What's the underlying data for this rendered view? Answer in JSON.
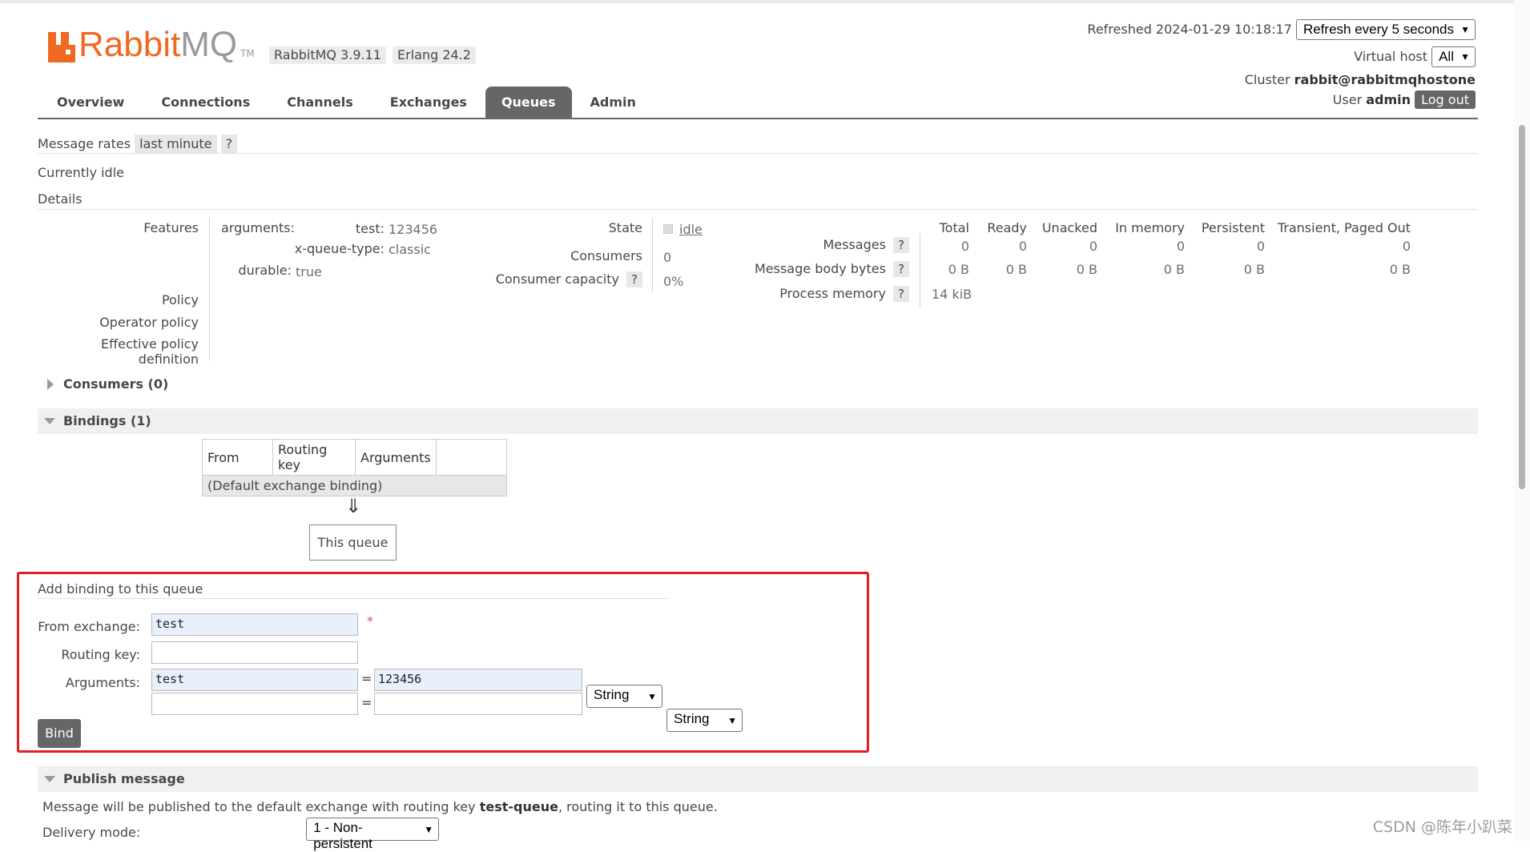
{
  "header": {
    "logo_brand": "Rabbit",
    "logo_brand_suffix": "MQ",
    "logo_tm": "TM",
    "version": "RabbitMQ 3.9.11",
    "erlang": "Erlang 24.2",
    "refreshed_label": "Refreshed 2024-01-29 10:18:17",
    "refresh_select": "Refresh every 5 seconds",
    "vhost_label": "Virtual host",
    "vhost_select": "All",
    "cluster_label": "Cluster",
    "cluster_value": "rabbit@rabbitmqhostone",
    "user_label": "User",
    "user_value": "admin",
    "logout_label": "Log out"
  },
  "tabs": [
    {
      "label": "Overview"
    },
    {
      "label": "Connections"
    },
    {
      "label": "Channels"
    },
    {
      "label": "Exchanges"
    },
    {
      "label": "Queues",
      "active": true
    },
    {
      "label": "Admin"
    }
  ],
  "rates": {
    "label": "Message rates",
    "period": "last minute",
    "help": "?",
    "status": "Currently idle"
  },
  "details": {
    "title": "Details",
    "features_label": "Features",
    "arguments_label": "arguments:",
    "arg1_key": "test:",
    "arg1_value": "123456",
    "arg2_key": "x-queue-type:",
    "arg2_value": "classic",
    "durable_key": "durable:",
    "durable_value": "true",
    "policy_label": "Policy",
    "operator_policy_label": "Operator policy",
    "effective_policy_label": "Effective policy definition",
    "state_label": "State",
    "state_value": "idle",
    "consumers_label": "Consumers",
    "consumers_value": "0",
    "capacity_label": "Consumer capacity",
    "capacity_help": "?",
    "capacity_value": "0%"
  },
  "stats": {
    "columns": [
      "Total",
      "Ready",
      "Unacked",
      "In memory",
      "Persistent",
      "Transient, Paged Out"
    ],
    "rows": [
      {
        "label": "Messages",
        "help": "?",
        "values": [
          "0",
          "0",
          "0",
          "0",
          "0",
          "0"
        ]
      },
      {
        "label": "Message body bytes",
        "help": "?",
        "values": [
          "0 B",
          "0 B",
          "0 B",
          "0 B",
          "0 B",
          "0 B"
        ]
      },
      {
        "label": "Process memory",
        "help": "?",
        "values": [
          "14 kiB"
        ]
      }
    ]
  },
  "consumers_section": {
    "title": "Consumers (0)"
  },
  "bindings_section": {
    "title": "Bindings (1)",
    "headers": [
      "From",
      "Routing key",
      "Arguments"
    ],
    "default_row": "(Default exchange binding)",
    "arrow": "⇓",
    "this_queue": "This queue"
  },
  "add_binding": {
    "title": "Add binding to this queue",
    "from_label": "From exchange:",
    "from_value": "test",
    "required_mark": "*",
    "routing_label": "Routing key:",
    "routing_value": "",
    "arguments_label": "Arguments:",
    "arg1_key": "test",
    "arg1_value": "123456",
    "arg1_type": "String",
    "arg2_key": "",
    "arg2_value": "",
    "arg2_type": "String",
    "equals": "=",
    "bind_label": "Bind"
  },
  "publish": {
    "title": "Publish message",
    "note_prefix": "Message will be published to the default exchange with routing key ",
    "note_key": "test-queue",
    "note_suffix": ", routing it to this queue.",
    "delivery_label": "Delivery mode:",
    "delivery_value": "1 - Non-persistent"
  },
  "watermark": "CSDN @陈年小趴菜",
  "colors": {
    "brand": "#f06a22",
    "tab_active": "#666666",
    "highlight_box": "#e11e1e"
  }
}
